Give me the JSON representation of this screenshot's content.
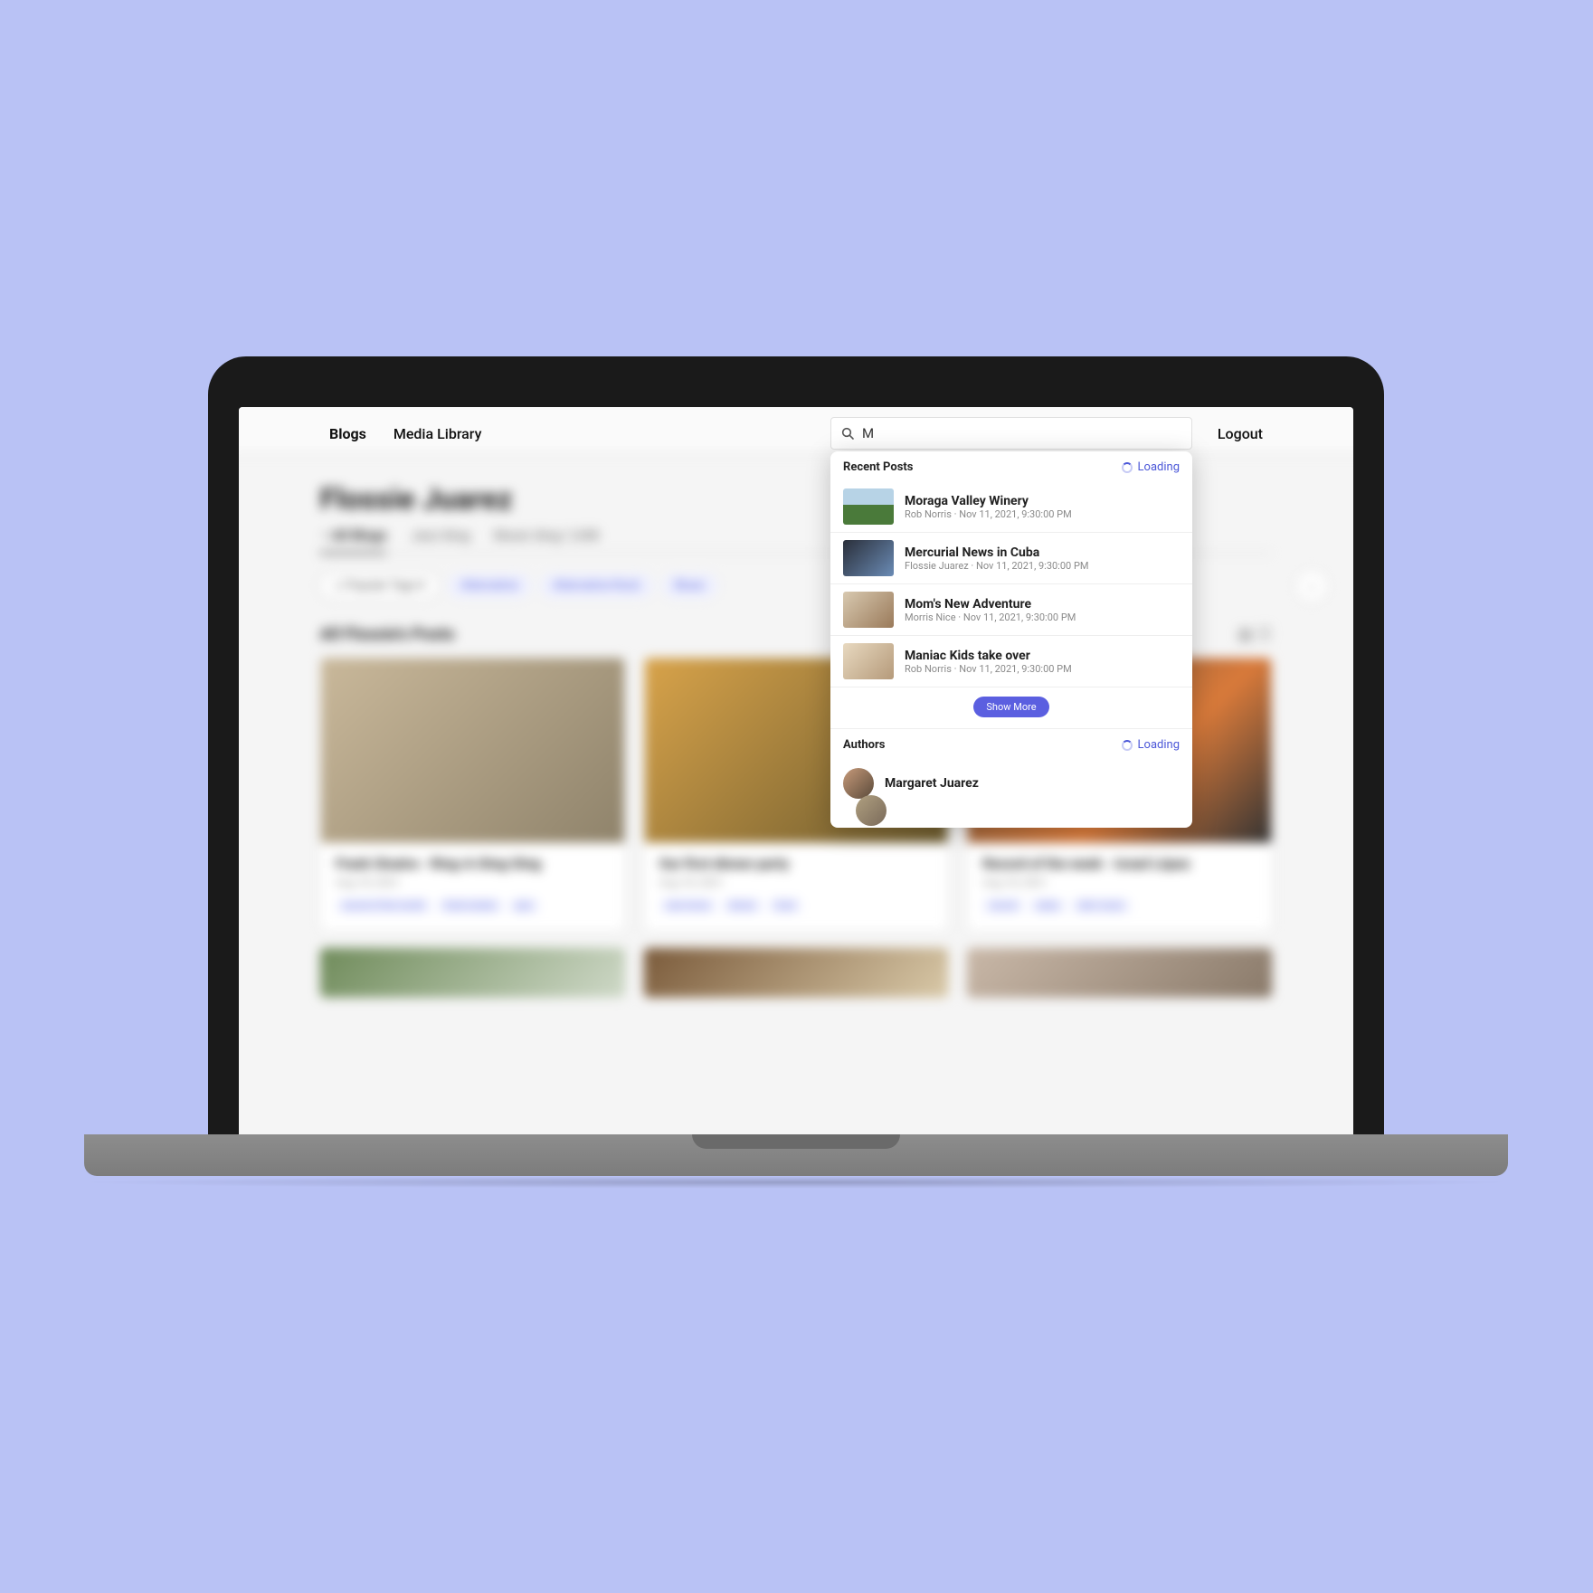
{
  "nav": {
    "blogs": "Blogs",
    "media_library": "Media Library",
    "logout": "Logout"
  },
  "search": {
    "value": "M"
  },
  "dropdown": {
    "recent_posts_label": "Recent Posts",
    "loading_label": "Loading",
    "posts": [
      {
        "title": "Moraga Valley Winery",
        "author": "Rob Norris",
        "sep": " · ",
        "timestamp": "Nov 11, 2021, 9:30:00 PM"
      },
      {
        "title": "Mercurial News in Cuba",
        "author": "Flossie Juarez",
        "sep": " · ",
        "timestamp": "Nov 11, 2021, 9:30:00 PM"
      },
      {
        "title": "Mom's New Adventure",
        "author": "Morris Nice",
        "sep": " · ",
        "timestamp": "Nov 11, 2021, 9:30:00 PM"
      },
      {
        "title": "Maniac Kids take over",
        "author": "Rob Norris",
        "sep": " · ",
        "timestamp": "Nov 11, 2021, 9:30:00 PM"
      }
    ],
    "show_more": "Show More",
    "authors_label": "Authors",
    "authors": [
      {
        "name": "Margaret Juarez"
      }
    ]
  },
  "background": {
    "page_title": "Flossie Juarez",
    "tabs": {
      "all_blogs": "All Blogs",
      "jazz_blog": "Jazz blog",
      "music_blog": "Music blog 1,048"
    },
    "popular_tags_label": "Popular Tags",
    "tags": {
      "alternative": "Alternative",
      "alternative_rock": "Alternative Rock",
      "blues": "Blues"
    },
    "section_title": "All Flossie's Posts",
    "cards": [
      {
        "title": "Frank Sinatra - Ring-A-Ding-Ding",
        "date": "Aug 18, 2021",
        "chips": {
          "c1": "record of the month",
          "c2": "frank sinatra",
          "c3": "jazz"
        }
      },
      {
        "title": "Our first dinner party",
        "date": "Aug 18, 2021",
        "chips": {
          "c1": "new home",
          "c2": "dinner",
          "c3": "food"
        }
      },
      {
        "title": "Record of the week - Israel López",
        "date": "Aug 18, 2021",
        "chips": {
          "c1": "record",
          "c2": "salsa",
          "c3": "latin music"
        }
      }
    ]
  }
}
